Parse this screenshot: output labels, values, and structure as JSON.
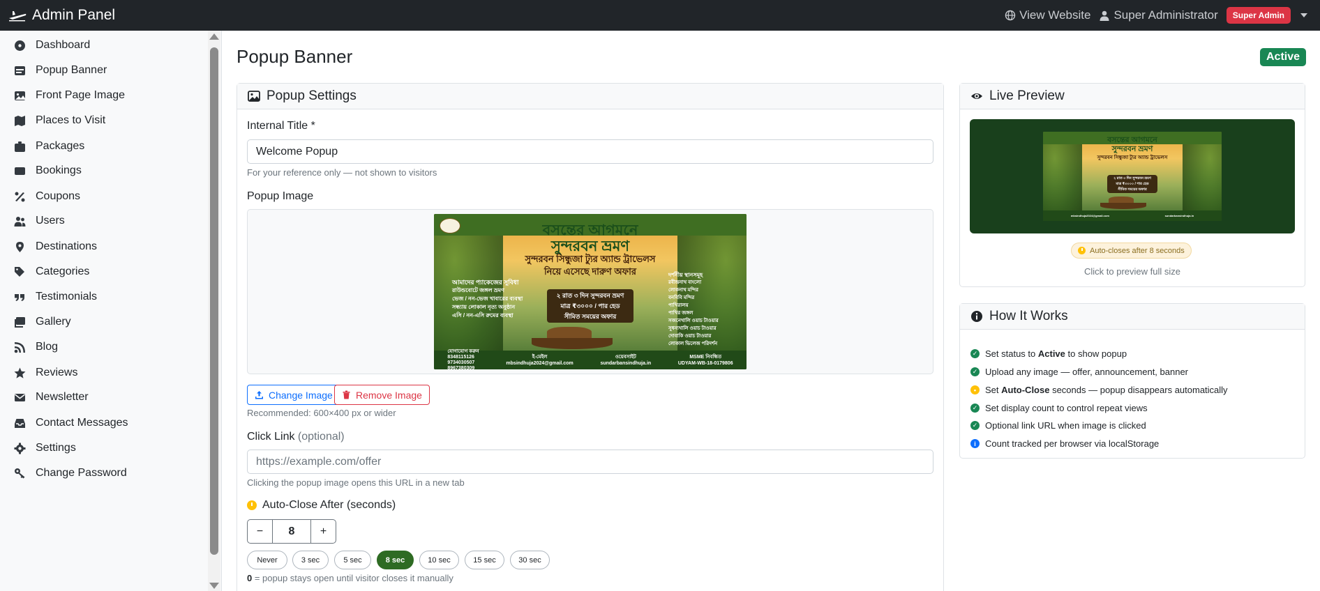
{
  "topbar": {
    "brand": "Admin Panel",
    "view_website": "View Website",
    "user_name": "Super Administrator",
    "role_badge": "Super Admin"
  },
  "sidebar": {
    "items": [
      {
        "label": "Dashboard",
        "icon": "dashboard-icon"
      },
      {
        "label": "Popup Banner",
        "icon": "popup-icon"
      },
      {
        "label": "Front Page Image",
        "icon": "image-icon"
      },
      {
        "label": "Places to Visit",
        "icon": "map-icon"
      },
      {
        "label": "Packages",
        "icon": "suitcase-icon"
      },
      {
        "label": "Bookings",
        "icon": "ticket-icon"
      },
      {
        "label": "Coupons",
        "icon": "percent-icon"
      },
      {
        "label": "Users",
        "icon": "users-icon"
      },
      {
        "label": "Destinations",
        "icon": "location-pin-icon"
      },
      {
        "label": "Categories",
        "icon": "tags-icon"
      },
      {
        "label": "Testimonials",
        "icon": "quote-icon"
      },
      {
        "label": "Gallery",
        "icon": "gallery-icon"
      },
      {
        "label": "Blog",
        "icon": "blog-icon"
      },
      {
        "label": "Reviews",
        "icon": "star-icon"
      },
      {
        "label": "Newsletter",
        "icon": "envelope-icon"
      },
      {
        "label": "Contact Messages",
        "icon": "inbox-icon"
      },
      {
        "label": "Settings",
        "icon": "gear-icon"
      },
      {
        "label": "Change Password",
        "icon": "key-icon"
      }
    ]
  },
  "page": {
    "title": "Popup Banner",
    "status": "Active"
  },
  "settings": {
    "header": "Popup Settings",
    "internal_title_label": "Internal Title *",
    "internal_title_value": "Welcome Popup",
    "internal_title_help": "For your reference only — not shown to visitors",
    "popup_image_label": "Popup Image",
    "change_image": "Change Image",
    "remove_image": "Remove Image",
    "image_help": "Recommended: 600×400 px or wider",
    "click_link_label": "Click Link",
    "click_link_optional": "(optional)",
    "click_link_placeholder": "https://example.com/offer",
    "click_link_help": "Clicking the popup image opens this URL in a new tab",
    "auto_close_label": "Auto-Close After (seconds)",
    "auto_close_minus": "−",
    "auto_close_value": "8",
    "auto_close_plus": "+",
    "presets": [
      "Never",
      "3 sec",
      "5 sec",
      "8 sec",
      "10 sec",
      "15 sec",
      "30 sec"
    ],
    "preset_selected": "8 sec",
    "zero_note_bold": "0",
    "zero_note": " = popup stays open until visitor closes it manually"
  },
  "banner": {
    "title_line1": "বসন্তের আগমনে",
    "title_line2": "সুন্দরবন ভ্রমণ",
    "subtitle_line1": "সুন্দরবন সিন্ধুজা ট্যুর অ্যান্ড ট্রাভেলস",
    "subtitle_line2": "নিয়ে এসেছে দারুণ অফার",
    "offer_line1": "২ রাত ৩ দিন সুন্দরবন ভ্রমণ",
    "offer_line2": "মাত্র ₹৩০০০ / পার হেড",
    "offer_line3": "সীমিত সময়ের অফার",
    "left_list_title": "আমাদের প্যাকেজের সুবিধা",
    "left_list": [
      "রাউন্ডবোটে জঙ্গল ভ্রমণ",
      "ভেজ / নন-ভেজ খাবারের ব্যবস্থা",
      "সন্ধ্যায় লোকাল নৃত্য অনুষ্ঠান",
      "এসি / নন-এসি রুমের ব্যবস্থা"
    ],
    "right_list_title": "দর্শনীয় স্থানসমূহ",
    "right_list": [
      "রবীন্দ্রনাথ বাংলো",
      "লোকনাথ মন্দির",
      "বনবিবি মন্দির",
      "পাখিরালয়",
      "পাখির জঙ্গল",
      "সজনেখালি ওয়াচ টাওয়ার",
      "সুধন্যখালি ওয়াচ টাওয়ার",
      "দোবাকি ওয়াচ টাওয়ার",
      "লোকাল ভিলেজ পরিদর্শন"
    ],
    "contact_label": "যোগাযোগ করুন",
    "phones": [
      "8348115126",
      "9734030507",
      "8967380309"
    ],
    "email_label": "ই-মেইল",
    "email": "mbsindhuja2024@gmail.com",
    "website_label": "ওয়েবসাইট",
    "website": "sundarbansindhuja.in",
    "msme_label": "MSME নিবন্ধিত",
    "msme": "UDYAM-WB-18-0179806"
  },
  "preview": {
    "header": "Live Preview",
    "auto_close_chip": "Auto-closes after 8 seconds",
    "hint": "Click to preview full size"
  },
  "how": {
    "header": "How It Works",
    "items": [
      {
        "pre": "Set status to ",
        "bold": "Active",
        "post": " to show popup",
        "color": "green"
      },
      {
        "pre": "Upload any image — offer, announcement, banner",
        "bold": "",
        "post": "",
        "color": "green"
      },
      {
        "pre": "Set ",
        "bold": "Auto-Close",
        "post": " seconds — popup disappears automatically",
        "color": "yellow"
      },
      {
        "pre": "Set display count to control repeat views",
        "bold": "",
        "post": "",
        "color": "green"
      },
      {
        "pre": "Optional link URL when image is clicked",
        "bold": "",
        "post": "",
        "color": "green"
      },
      {
        "pre": "Count tracked per browser via localStorage",
        "bold": "",
        "post": "",
        "color": "blue"
      }
    ]
  },
  "colors": {
    "navbar": "#212529",
    "success": "#198754",
    "danger": "#dc3545",
    "primary": "#0d6efd",
    "warning": "#ffc107",
    "preset_active": "#2e6b23"
  }
}
